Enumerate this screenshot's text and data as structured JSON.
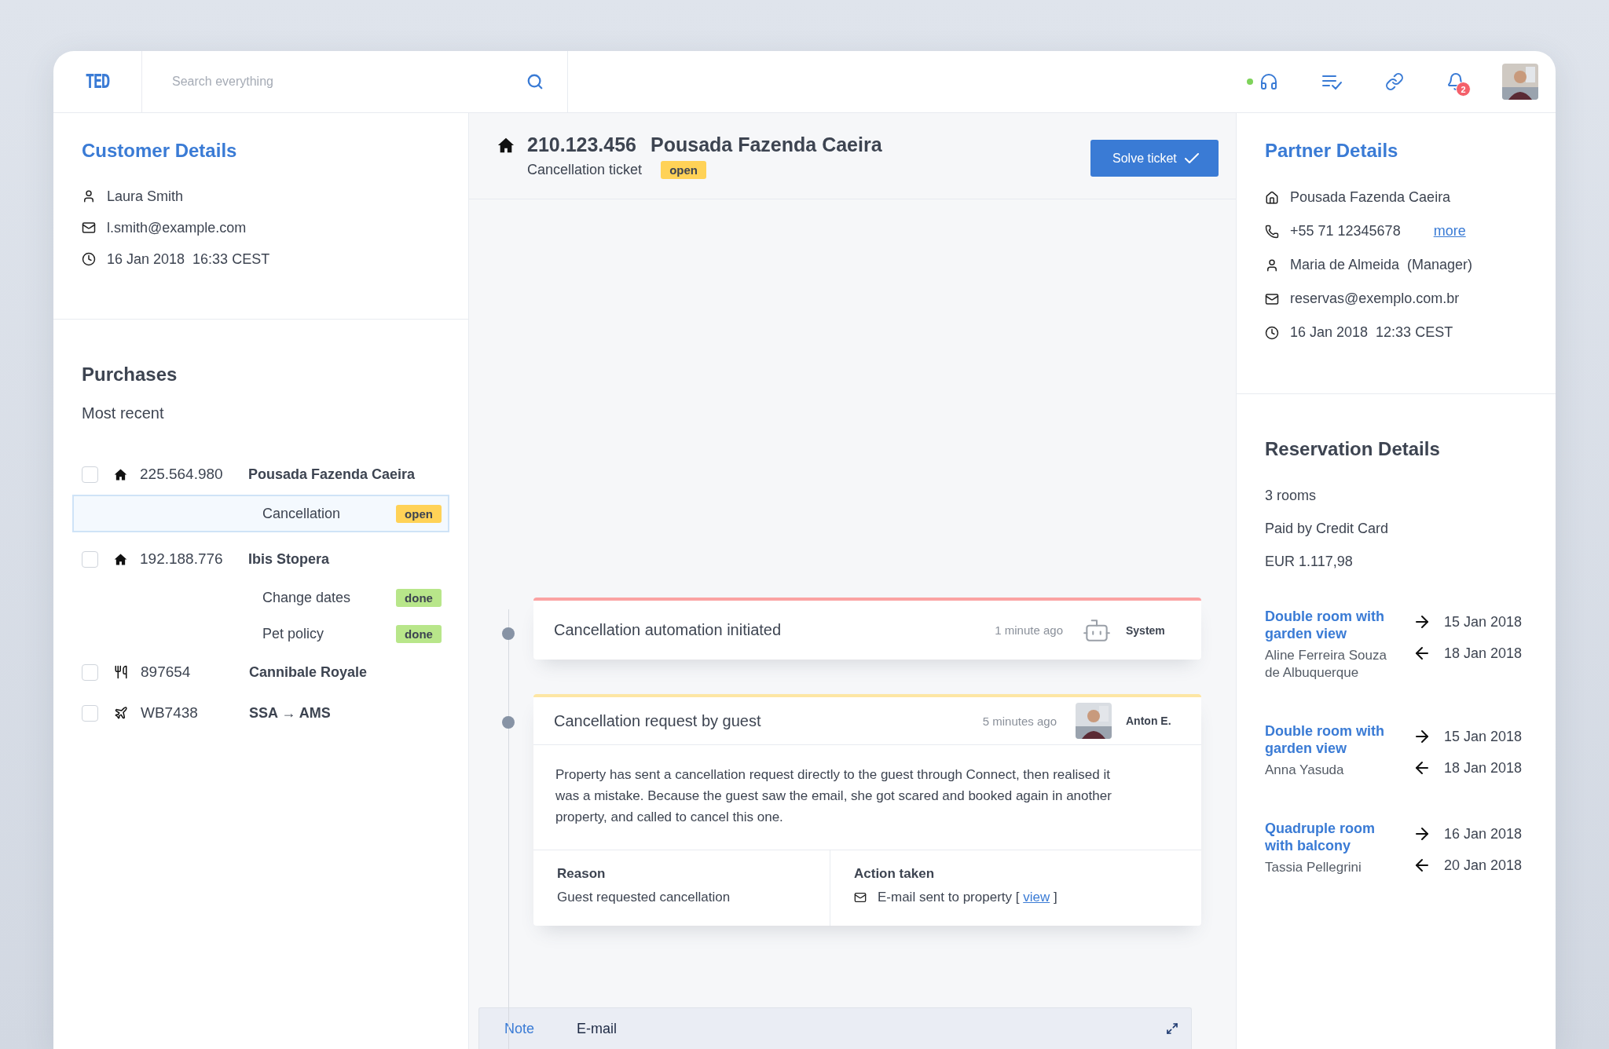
{
  "topbar": {
    "logo": "TED",
    "search": {
      "placeholder": "Search everything"
    },
    "online": true,
    "notifications": "2"
  },
  "customer": {
    "title": "Customer Details",
    "rows": [
      {
        "kind": "person",
        "text": "Laura Smith"
      },
      {
        "kind": "email",
        "text": "l.smith@example.com"
      },
      {
        "kind": "time",
        "text": "16 Jan 2018  16:33 CEST"
      }
    ]
  },
  "purchases": {
    "title": "Purchases",
    "subtitle": "Most recent",
    "items": [
      {
        "kind": "hotel",
        "checked": false,
        "number": "225.564.980",
        "name": "Pousada Fazenda Caeira",
        "tasks": [
          {
            "label": "Cancellation",
            "status": "open",
            "selected": true
          }
        ]
      },
      {
        "kind": "hotel",
        "checked": false,
        "number": "192.188.776",
        "name": "Ibis Stopera",
        "tasks": [
          {
            "label": "Change dates",
            "status": "done",
            "selected": false
          },
          {
            "label": "Pet policy",
            "status": "done",
            "selected": false
          }
        ]
      },
      {
        "kind": "restaurant",
        "checked": false,
        "number": "897654",
        "name": "Cannibale Royale"
      },
      {
        "kind": "flight",
        "checked": false,
        "number": "WB7438",
        "name": "SSA → AMS"
      }
    ]
  },
  "ticket": {
    "number": "210.123.456",
    "name": "Pousada Fazenda Caeira",
    "type": "Cancellation ticket",
    "status": "open",
    "button": "Solve ticket"
  },
  "timeline": [
    {
      "kind": "system",
      "color": "#fba3a3",
      "title": "Cancellation automation initiated",
      "time": "1 minute ago",
      "author": "System"
    },
    {
      "kind": "person",
      "color": "#fde6a4",
      "title": "Cancellation request by guest",
      "time": "5 minutes ago",
      "author": "Anton E.",
      "body": "Property has sent a cancellation request directly to the guest through Connect, then realised it was a mistake. Because the guest saw the email, she got scared and booked again in another property, and called to cancel this one.",
      "reason_label": "Reason",
      "reason": "Guest requested cancellation",
      "action_label": "Action taken",
      "action_text": "E-mail sent to property [",
      "action_link": "view",
      "action_end": "]"
    }
  ],
  "composer": {
    "tabs": [
      {
        "label": "Note",
        "selected": true
      },
      {
        "label": "E-mail",
        "selected": false
      }
    ]
  },
  "partner": {
    "title": "Partner Details",
    "rows": [
      {
        "kind": "home",
        "text": "Pousada Fazenda Caeira"
      },
      {
        "kind": "phone",
        "text": "+55 71 12345678",
        "link": "more"
      },
      {
        "kind": "person",
        "text": "Maria de Almeida  (Manager)"
      },
      {
        "kind": "email",
        "text": "reservas@exemplo.com.br"
      },
      {
        "kind": "time",
        "text": "16 Jan 2018  12:33 CEST"
      }
    ]
  },
  "reservation": {
    "title": "Reservation Details",
    "facts": [
      "3 rooms",
      "Paid by Credit Card",
      "EUR 1.117,98"
    ],
    "rooms": [
      {
        "name": "Double room with garden view",
        "guest": "Aline Ferreira Souza de Albuquerque",
        "checkin": "15 Jan 2018",
        "checkout": "18 Jan 2018"
      },
      {
        "name": "Double room with garden view",
        "guest": "Anna Yasuda",
        "checkin": "15 Jan 2018",
        "checkout": "18 Jan 2018"
      },
      {
        "name": "Quadruple room with balcony",
        "guest": "Tassia Pellegrini",
        "checkin": "16 Jan 2018",
        "checkout": "20 Jan 2018"
      }
    ]
  }
}
